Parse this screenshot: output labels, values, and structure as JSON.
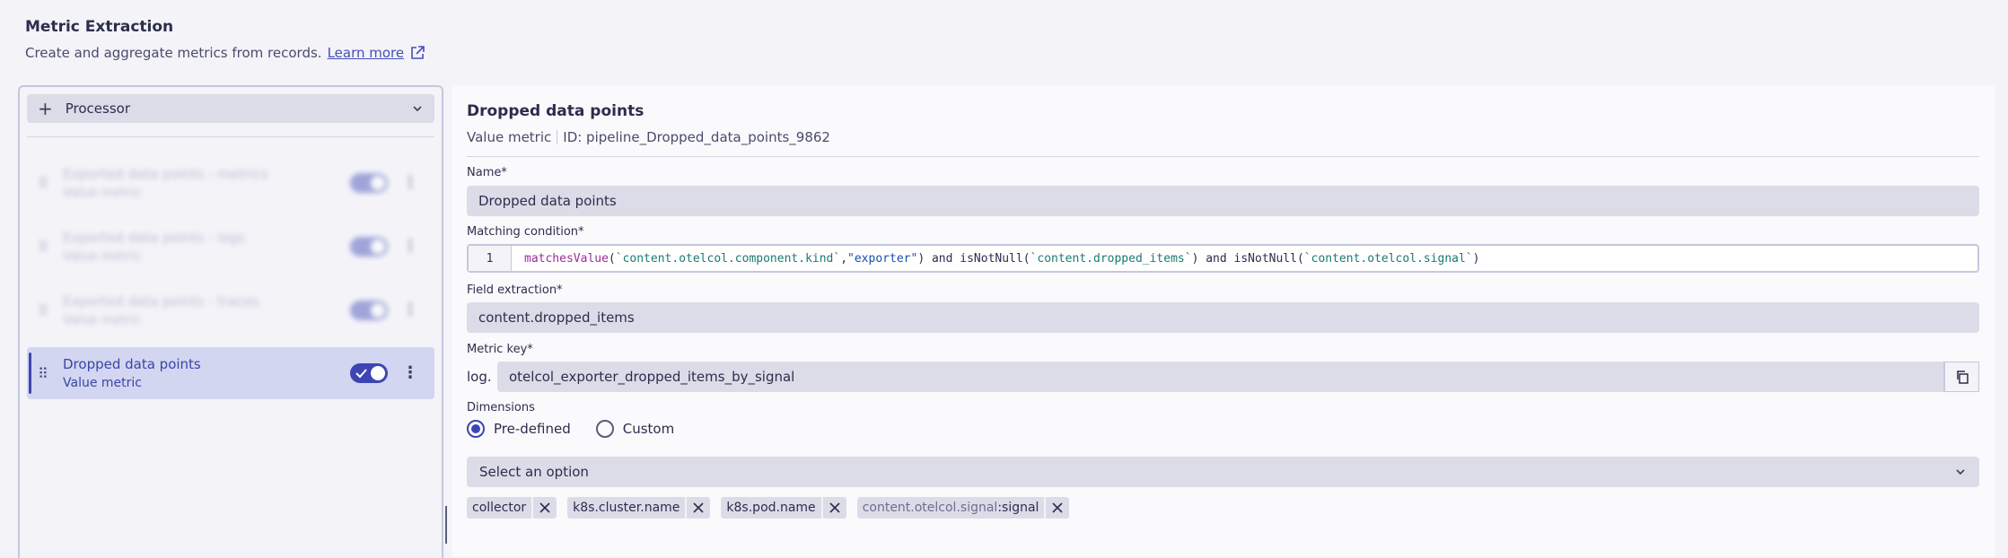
{
  "page": {
    "title": "Metric Extraction",
    "subtitle": "Create and aggregate metrics from records.",
    "learn_more": "Learn more"
  },
  "sidebar": {
    "processor_label": "Processor",
    "items": [
      {
        "title": "Exported data points - metrics",
        "subtitle": "Value metric",
        "enabled": true,
        "blurred": true
      },
      {
        "title": "Exported data points - logs",
        "subtitle": "Value metric",
        "enabled": true,
        "blurred": true
      },
      {
        "title": "Exported data points - traces",
        "subtitle": "Value metric",
        "enabled": true,
        "blurred": true
      },
      {
        "title": "Dropped data points",
        "subtitle": "Value metric",
        "enabled": true,
        "blurred": false
      }
    ]
  },
  "detail": {
    "title": "Dropped data points",
    "type": "Value metric",
    "id": "ID: pipeline_Dropped_data_points_9862",
    "name_label": "Name*",
    "name_value": "Dropped data points",
    "matching_label": "Matching condition*",
    "matching_line_number": "1",
    "matching_tokens": [
      {
        "text": "matchesValue",
        "kind": "fn"
      },
      {
        "text": "(",
        "kind": "plain"
      },
      {
        "text": "`content.otelcol.component.kind`",
        "kind": "field"
      },
      {
        "text": ",",
        "kind": "plain"
      },
      {
        "text": "\"exporter\"",
        "kind": "str"
      },
      {
        "text": ") and isNotNull(",
        "kind": "plain"
      },
      {
        "text": "`content.dropped_items`",
        "kind": "field"
      },
      {
        "text": ") and isNotNull(",
        "kind": "plain"
      },
      {
        "text": "`content.otelcol.signal`",
        "kind": "field"
      },
      {
        "text": ")",
        "kind": "plain"
      }
    ],
    "field_extraction_label": "Field extraction*",
    "field_extraction_value": "content.dropped_items",
    "metric_key_label": "Metric key*",
    "metric_key_prefix": "log.",
    "metric_key_value": "otelcol_exporter_dropped_items_by_signal",
    "dimensions_label": "Dimensions",
    "radio_predefined": "Pre-defined",
    "radio_custom": "Custom",
    "radio_selected": "Pre-defined",
    "select_placeholder": "Select an option",
    "chips": [
      {
        "label": "collector",
        "suffix": ""
      },
      {
        "label": "k8s.cluster.name",
        "suffix": ""
      },
      {
        "label": "k8s.pod.name",
        "suffix": ""
      },
      {
        "label": "content.otelcol.signal",
        "suffix": ":signal"
      }
    ]
  },
  "colors": {
    "accent": "#3d45b5",
    "input_bg": "#dcdce8",
    "page_bg": "#f3f3f8"
  }
}
